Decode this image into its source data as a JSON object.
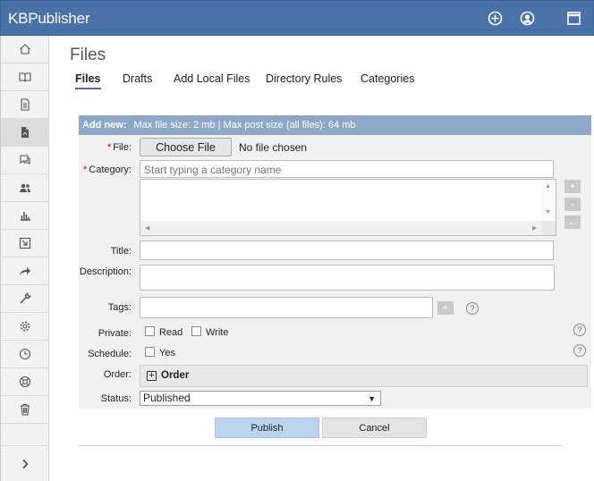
{
  "app": {
    "title": "KBPublisher"
  },
  "header_icons": [
    "plus-circle-icon",
    "user-icon",
    "window-icon"
  ],
  "sidebar": {
    "items": [
      {
        "icon": "home-icon"
      },
      {
        "icon": "book-icon"
      },
      {
        "icon": "document-icon"
      },
      {
        "icon": "file-icon",
        "active": true
      },
      {
        "icon": "chat-icon"
      },
      {
        "icon": "users-icon"
      },
      {
        "icon": "chart-icon"
      },
      {
        "icon": "import-icon"
      },
      {
        "icon": "share-icon"
      },
      {
        "icon": "wrench-icon"
      },
      {
        "icon": "gear-icon"
      },
      {
        "icon": "clock-icon"
      },
      {
        "icon": "lifebuoy-icon"
      },
      {
        "icon": "trash-icon"
      }
    ],
    "expand_icon": "chevron-right-icon"
  },
  "page": {
    "title": "Files",
    "tabs": [
      {
        "label": "Files",
        "active": true
      },
      {
        "label": "Drafts"
      },
      {
        "label": "Add Local Files"
      },
      {
        "label": "Directory Rules"
      },
      {
        "label": "Categories"
      }
    ]
  },
  "form": {
    "add_new": "Add new:",
    "limits": "Max file size: 2 mb | Max post size (all files): 64 mb",
    "file_label": "File:",
    "choose_file": "Choose File",
    "no_file": "No file chosen",
    "category_label": "Category:",
    "category_placeholder": "Start typing a category name",
    "category_buttons": [
      "+",
      "-",
      "←"
    ],
    "title_label": "Title:",
    "description_label": "Description:",
    "tags_label": "Tags:",
    "tags_add": "+",
    "private_label": "Private:",
    "private_read": "Read",
    "private_write": "Write",
    "schedule_label": "Schedule:",
    "schedule_yes": "Yes",
    "order_label": "Order:",
    "order_toggle": "Order",
    "status_label": "Status:",
    "status_value": "Published",
    "help": "?"
  },
  "actions": {
    "publish": "Publish",
    "cancel": "Cancel"
  }
}
